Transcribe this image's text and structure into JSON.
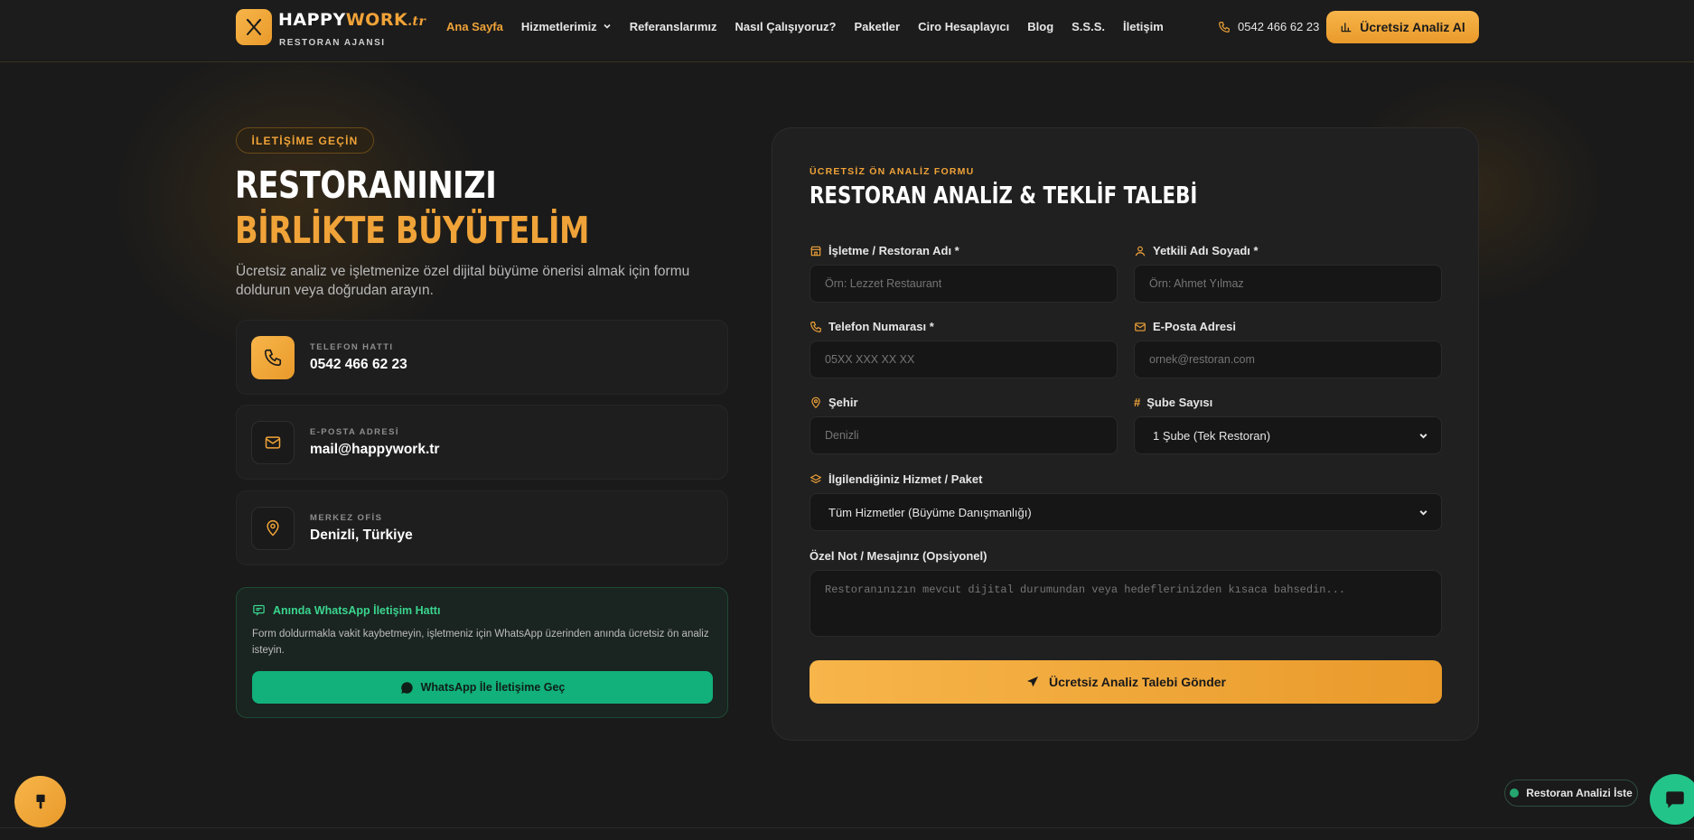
{
  "header": {
    "brand": {
      "part1": "HAPPY",
      "part2": "WORK",
      "part3": ".tr",
      "subtitle": "RESTORAN AJANSI"
    },
    "nav": [
      {
        "label": "Ana Sayfa",
        "active": true
      },
      {
        "label": "Hizmetlerimiz",
        "dropdown": true
      },
      {
        "label": "Referanslarımız"
      },
      {
        "label": "Nasıl Çalışıyoruz?"
      },
      {
        "label": "Paketler"
      },
      {
        "label": "Ciro Hesaplayıcı"
      },
      {
        "label": "Blog"
      },
      {
        "label": "S.S.S."
      },
      {
        "label": "İletişim"
      }
    ],
    "phone": "0542 466 62 23",
    "cta_label": "Ücretsiz Analiz Al"
  },
  "hero": {
    "badge": "İLETİŞİME GEÇİN",
    "title_line1": "RESTORANINIZI",
    "title_line2": "BİRLİKTE BÜYÜTELİM",
    "description": "Ücretsiz analiz ve işletmenize özel dijital büyüme önerisi almak için formu doldurun veya doğrudan arayın."
  },
  "contacts": [
    {
      "label": "TELEFON HATTI",
      "value": "0542 466 62 23",
      "icon": "phone-icon"
    },
    {
      "label": "E-POSTA ADRESİ",
      "value": "mail@happywork.tr",
      "icon": "mail-icon"
    },
    {
      "label": "MERKEZ OFİS",
      "value": "Denizli, Türkiye",
      "icon": "map-pin-icon"
    }
  ],
  "whatsapp": {
    "title": "Anında WhatsApp İletişim Hattı",
    "description": "Form doldurmakla vakit kaybetmeyin, işletmeniz için WhatsApp üzerinden anında ücretsiz ön analiz isteyin.",
    "button_label": "WhatsApp İle İletişime Geç"
  },
  "form": {
    "kicker": "ÜCRETSİZ ÖN ANALİZ FORMU",
    "title": "RESTORAN ANALİZ & TEKLİF TALEBİ",
    "fields": {
      "business_name": {
        "label": "İşletme / Restoran Adı *",
        "placeholder": "Örn: Lezzet Restaurant"
      },
      "contact_name": {
        "label": "Yetkili Adı Soyadı *",
        "placeholder": "Örn: Ahmet Yılmaz"
      },
      "phone": {
        "label": "Telefon Numarası *",
        "placeholder": "05XX XXX XX XX"
      },
      "email": {
        "label": "E-Posta Adresi",
        "placeholder": "ornek@restoran.com"
      },
      "city": {
        "label": "Şehir",
        "placeholder": "Denizli"
      },
      "branch_count": {
        "label": "Şube Sayısı",
        "value": "1 Şube (Tek Restoran)"
      },
      "service": {
        "label": "İlgilendiğiniz Hizmet / Paket",
        "value": "Tüm Hizmetler (Büyüme Danışmanlığı)"
      },
      "message": {
        "label": "Özel Not / Mesajınız (Opsiyonel)",
        "placeholder": "Restoranınızın mevcut dijital durumundan veya hedeflerinizden kısaca bahsedin..."
      }
    },
    "submit_label": "Ücretsiz Analiz Talebi Gönder"
  },
  "floating": {
    "pill_label": "Restoran Analizi İste"
  },
  "colors": {
    "accent": "#f0a338",
    "background": "#1a1a1a",
    "whatsapp": "#12b07a"
  }
}
